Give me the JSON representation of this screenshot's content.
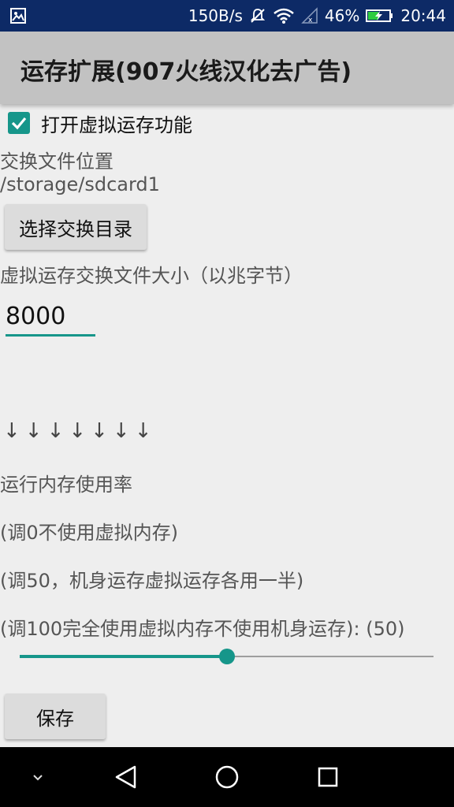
{
  "status_bar": {
    "speed": "150B/s",
    "battery": "46%",
    "time": "20:44",
    "icons": [
      "image-icon",
      "mute-icon",
      "wifi-icon",
      "signal-icon",
      "battery-icon"
    ]
  },
  "app_bar": {
    "title": "运存扩展(907火线汉化去广告)"
  },
  "settings": {
    "enable_checkbox": {
      "label": "打开虚拟运存功能",
      "checked": true
    },
    "swap_location_label": "交换文件位置",
    "swap_path": "/storage/sdcard1",
    "choose_dir_button": "选择交换目录",
    "swap_size_label": "虚拟运存交换文件大小（以兆字节）",
    "swap_size_value": "8000",
    "arrows": "↓↓↓↓↓↓↓",
    "usage_title": "运行内存使用率",
    "hint_0": "(调0不使用虚拟内存)",
    "hint_50": "(调50，机身运存虚拟运存各用一半)",
    "hint_100": "(调100完全使用虚拟内存不使用机身运存): (50)",
    "slider_value": 50,
    "save_button": "保存"
  },
  "colors": {
    "accent": "#16968a",
    "status_bar": "#0d2a66",
    "app_bar": "#c2c2c2",
    "background": "#eeeeee"
  }
}
